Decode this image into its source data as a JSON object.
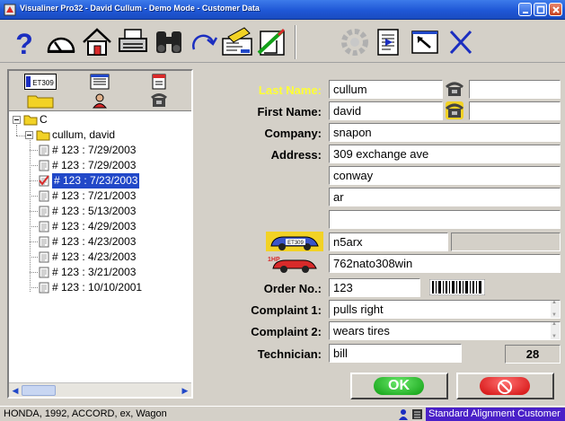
{
  "window": {
    "title": "Visualiner Pro32 - David Cullum - Demo Mode - Customer Data"
  },
  "toolbar": {
    "items": [
      "help-icon",
      "alignment-gauge-icon",
      "home-icon",
      "printer-icon",
      "binoculars-icon",
      "search-icon",
      "redo-icon",
      "vehicle-specs-icon",
      "adjust-icon",
      "gear-icon",
      "clipboard-icon",
      "pointer-icon",
      "cancel-icon"
    ]
  },
  "left_pane": {
    "tab_badge": "ET309",
    "tree": {
      "root": "C",
      "customer": "cullum, david",
      "records": [
        "# 123 : 7/29/2003",
        "# 123 : 7/29/2003",
        "# 123 : 7/23/2003",
        "# 123 : 7/21/2003",
        "# 123 : 5/13/2003",
        "# 123 : 4/29/2003",
        "# 123 : 4/23/2003",
        "# 123 : 4/23/2003",
        "# 123 : 3/21/2003",
        "# 123 : 10/10/2001"
      ],
      "selected_index": 2
    }
  },
  "form": {
    "last_name_label": "Last Name:",
    "last_name": "cullum",
    "first_name_label": "First Name:",
    "first_name": "david",
    "company_label": "Company:",
    "company": "snapon",
    "address_label": "Address:",
    "address1": "309 exchange ave",
    "address2": "conway",
    "address3": "ar",
    "address4": "",
    "license_badge": "ET309",
    "license": "n5arx",
    "vin_badge": "1HP",
    "vin": "762nato308win",
    "order_label": "Order No.:",
    "order_no": "123",
    "complaint1_label": "Complaint 1:",
    "complaint1": "pulls right",
    "complaint2_label": "Complaint 2:",
    "complaint2": "wears tires",
    "technician_label": "Technician:",
    "technician": "bill",
    "count": "28"
  },
  "buttons": {
    "ok": "OK"
  },
  "status": {
    "vehicle": "HONDA, 1992, ACCORD, ex, Wagon",
    "mode": "Standard Alignment Customer"
  },
  "colors": {
    "title_bar": "#1f57d6",
    "highlight_label": "#ffff33",
    "selection": "#2148c8",
    "ok_green": "#0e9e12",
    "cancel_red": "#d10b0b",
    "mode_bar": "#4a20c8"
  }
}
